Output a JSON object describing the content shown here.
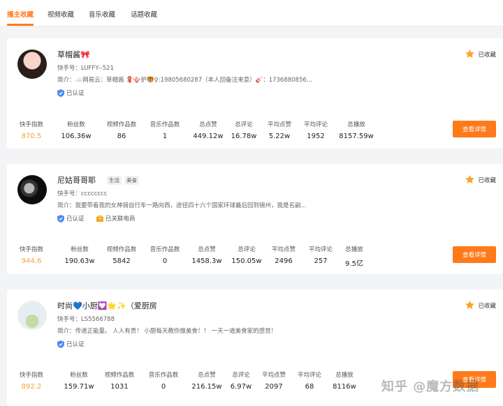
{
  "tabs": [
    {
      "label": "播主收藏"
    },
    {
      "label": "视频收藏"
    },
    {
      "label": "音乐收藏"
    },
    {
      "label": "话题收藏"
    }
  ],
  "colors": {
    "accent": "#ff7a1a",
    "index_value": "#f2a33a",
    "verified": "#4a8df0",
    "star": "#f6a623"
  },
  "stat_labels": [
    "快手指数",
    "粉丝数",
    "视频作品数",
    "音乐作品数",
    "总点赞",
    "总评论",
    "平均点赞",
    "平均评论",
    "总播放"
  ],
  "favorite_label": "已收藏",
  "detail_label": "查看详情",
  "cards": [
    {
      "name": "草帽酱🎀",
      "uid": "快手号：LUFFY--521",
      "bio": "简介：☁️网易云：草帽酱 🧣🪸护🐯♀:19805680287（本人回备注来意）🎸：1736880856...",
      "verified": "已认证",
      "values": [
        "870.5",
        "106.36w",
        "86",
        "1",
        "449.12w",
        "16.78w",
        "5.22w",
        "1952",
        "8157.59w"
      ]
    },
    {
      "name": "尼姑哥哥耶",
      "tags": [
        "生活",
        "美食"
      ],
      "uid": "快手号：cccccccc",
      "bio": "简介：我要带着我的女神骑自行车一路向西，途径四十六个国家环球最后回到锦州，我是名副...",
      "verified": "已认证",
      "ecommerce": "已关联电商",
      "values": [
        "944.6",
        "190.63w",
        "5842",
        "0",
        "1458.3w",
        "150.05w",
        "2496",
        "257",
        "9.5亿"
      ]
    },
    {
      "name": "时尚💙小厨💟🌟✨（爱厨房",
      "uid": "快手号：LS5566788",
      "bio": "简介：传递正能量。 人人有责！ 小厨每天教你做美食！！ 一天一道美食家的感觉！",
      "verified": "已认证",
      "values": [
        "892.2",
        "159.71w",
        "1031",
        "0",
        "216.15w",
        "6.97w",
        "2097",
        "68",
        "8116w"
      ]
    }
  ],
  "watermark": "知乎 @魔方数据"
}
